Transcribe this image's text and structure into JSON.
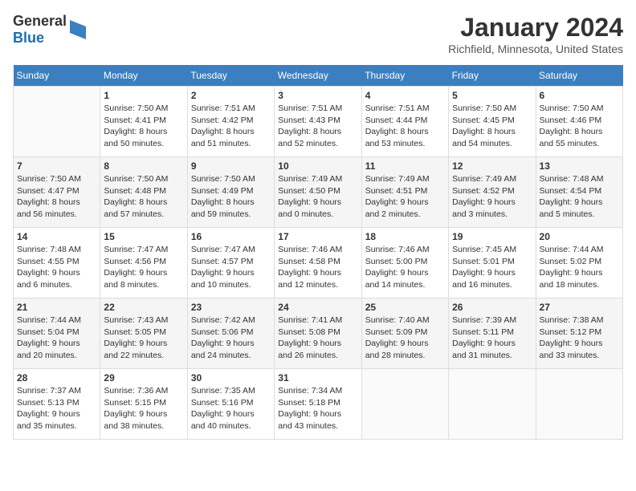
{
  "header": {
    "logo_general": "General",
    "logo_blue": "Blue",
    "month": "January 2024",
    "location": "Richfield, Minnesota, United States"
  },
  "weekdays": [
    "Sunday",
    "Monday",
    "Tuesday",
    "Wednesday",
    "Thursday",
    "Friday",
    "Saturday"
  ],
  "weeks": [
    [
      {
        "day": "",
        "info": ""
      },
      {
        "day": "1",
        "info": "Sunrise: 7:50 AM\nSunset: 4:41 PM\nDaylight: 8 hours\nand 50 minutes."
      },
      {
        "day": "2",
        "info": "Sunrise: 7:51 AM\nSunset: 4:42 PM\nDaylight: 8 hours\nand 51 minutes."
      },
      {
        "day": "3",
        "info": "Sunrise: 7:51 AM\nSunset: 4:43 PM\nDaylight: 8 hours\nand 52 minutes."
      },
      {
        "day": "4",
        "info": "Sunrise: 7:51 AM\nSunset: 4:44 PM\nDaylight: 8 hours\nand 53 minutes."
      },
      {
        "day": "5",
        "info": "Sunrise: 7:50 AM\nSunset: 4:45 PM\nDaylight: 8 hours\nand 54 minutes."
      },
      {
        "day": "6",
        "info": "Sunrise: 7:50 AM\nSunset: 4:46 PM\nDaylight: 8 hours\nand 55 minutes."
      }
    ],
    [
      {
        "day": "7",
        "info": "Sunrise: 7:50 AM\nSunset: 4:47 PM\nDaylight: 8 hours\nand 56 minutes."
      },
      {
        "day": "8",
        "info": "Sunrise: 7:50 AM\nSunset: 4:48 PM\nDaylight: 8 hours\nand 57 minutes."
      },
      {
        "day": "9",
        "info": "Sunrise: 7:50 AM\nSunset: 4:49 PM\nDaylight: 8 hours\nand 59 minutes."
      },
      {
        "day": "10",
        "info": "Sunrise: 7:49 AM\nSunset: 4:50 PM\nDaylight: 9 hours\nand 0 minutes."
      },
      {
        "day": "11",
        "info": "Sunrise: 7:49 AM\nSunset: 4:51 PM\nDaylight: 9 hours\nand 2 minutes."
      },
      {
        "day": "12",
        "info": "Sunrise: 7:49 AM\nSunset: 4:52 PM\nDaylight: 9 hours\nand 3 minutes."
      },
      {
        "day": "13",
        "info": "Sunrise: 7:48 AM\nSunset: 4:54 PM\nDaylight: 9 hours\nand 5 minutes."
      }
    ],
    [
      {
        "day": "14",
        "info": "Sunrise: 7:48 AM\nSunset: 4:55 PM\nDaylight: 9 hours\nand 6 minutes."
      },
      {
        "day": "15",
        "info": "Sunrise: 7:47 AM\nSunset: 4:56 PM\nDaylight: 9 hours\nand 8 minutes."
      },
      {
        "day": "16",
        "info": "Sunrise: 7:47 AM\nSunset: 4:57 PM\nDaylight: 9 hours\nand 10 minutes."
      },
      {
        "day": "17",
        "info": "Sunrise: 7:46 AM\nSunset: 4:58 PM\nDaylight: 9 hours\nand 12 minutes."
      },
      {
        "day": "18",
        "info": "Sunrise: 7:46 AM\nSunset: 5:00 PM\nDaylight: 9 hours\nand 14 minutes."
      },
      {
        "day": "19",
        "info": "Sunrise: 7:45 AM\nSunset: 5:01 PM\nDaylight: 9 hours\nand 16 minutes."
      },
      {
        "day": "20",
        "info": "Sunrise: 7:44 AM\nSunset: 5:02 PM\nDaylight: 9 hours\nand 18 minutes."
      }
    ],
    [
      {
        "day": "21",
        "info": "Sunrise: 7:44 AM\nSunset: 5:04 PM\nDaylight: 9 hours\nand 20 minutes."
      },
      {
        "day": "22",
        "info": "Sunrise: 7:43 AM\nSunset: 5:05 PM\nDaylight: 9 hours\nand 22 minutes."
      },
      {
        "day": "23",
        "info": "Sunrise: 7:42 AM\nSunset: 5:06 PM\nDaylight: 9 hours\nand 24 minutes."
      },
      {
        "day": "24",
        "info": "Sunrise: 7:41 AM\nSunset: 5:08 PM\nDaylight: 9 hours\nand 26 minutes."
      },
      {
        "day": "25",
        "info": "Sunrise: 7:40 AM\nSunset: 5:09 PM\nDaylight: 9 hours\nand 28 minutes."
      },
      {
        "day": "26",
        "info": "Sunrise: 7:39 AM\nSunset: 5:11 PM\nDaylight: 9 hours\nand 31 minutes."
      },
      {
        "day": "27",
        "info": "Sunrise: 7:38 AM\nSunset: 5:12 PM\nDaylight: 9 hours\nand 33 minutes."
      }
    ],
    [
      {
        "day": "28",
        "info": "Sunrise: 7:37 AM\nSunset: 5:13 PM\nDaylight: 9 hours\nand 35 minutes."
      },
      {
        "day": "29",
        "info": "Sunrise: 7:36 AM\nSunset: 5:15 PM\nDaylight: 9 hours\nand 38 minutes."
      },
      {
        "day": "30",
        "info": "Sunrise: 7:35 AM\nSunset: 5:16 PM\nDaylight: 9 hours\nand 40 minutes."
      },
      {
        "day": "31",
        "info": "Sunrise: 7:34 AM\nSunset: 5:18 PM\nDaylight: 9 hours\nand 43 minutes."
      },
      {
        "day": "",
        "info": ""
      },
      {
        "day": "",
        "info": ""
      },
      {
        "day": "",
        "info": ""
      }
    ]
  ]
}
